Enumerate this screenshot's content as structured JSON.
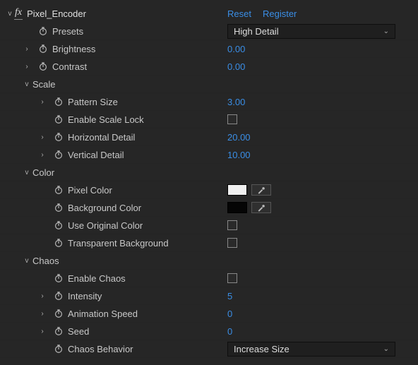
{
  "header": {
    "fx_badge": "fx",
    "effect_name": "Pixel_Encoder",
    "reset": "Reset",
    "register": "Register"
  },
  "presets": {
    "label": "Presets",
    "value": "High Detail"
  },
  "brightness": {
    "label": "Brightness",
    "value": "0.00"
  },
  "contrast": {
    "label": "Contrast",
    "value": "0.00"
  },
  "scale": {
    "label": "Scale",
    "pattern_size": {
      "label": "Pattern Size",
      "value": "3.00"
    },
    "enable_scale_lock": {
      "label": "Enable Scale Lock"
    },
    "horizontal_detail": {
      "label": "Horizontal Detail",
      "value": "20.00"
    },
    "vertical_detail": {
      "label": "Vertical Detail",
      "value": "10.00"
    }
  },
  "color": {
    "label": "Color",
    "pixel_color": {
      "label": "Pixel Color",
      "swatch": "#f0f0f0"
    },
    "background_color": {
      "label": "Background Color",
      "swatch": "#050505"
    },
    "use_original_color": {
      "label": "Use Original Color"
    },
    "transparent_bg": {
      "label": "Transparent Background"
    }
  },
  "chaos": {
    "label": "Chaos",
    "enable_chaos": {
      "label": "Enable Chaos"
    },
    "intensity": {
      "label": "Intensity",
      "value": "5"
    },
    "animation_speed": {
      "label": "Animation Speed",
      "value": "0"
    },
    "seed": {
      "label": "Seed",
      "value": "0"
    },
    "behavior": {
      "label": "Chaos Behavior",
      "value": "Increase Size"
    }
  }
}
